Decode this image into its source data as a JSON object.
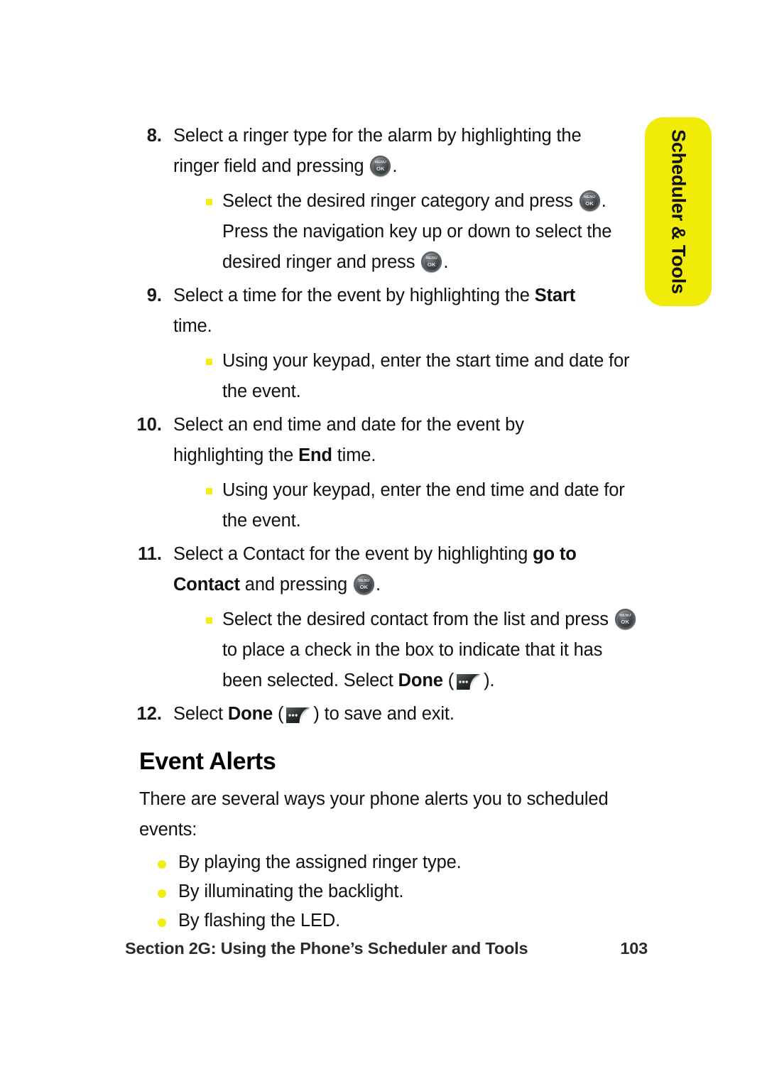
{
  "page": {
    "side_tab_label": "Scheduler & Tools",
    "tab_color": "#F0EC08",
    "bullet_color": "#F2EE12"
  },
  "icons": {
    "menu_ok": {
      "name": "menu-ok-key-icon",
      "top": "MENU",
      "bottom": "OK"
    },
    "softkey_done": {
      "name": "left-softkey-icon",
      "dots": "•••"
    }
  },
  "steps": [
    {
      "number": "8.",
      "text_a": "Select a ringer type for the alarm by highlighting the ringer field and pressing ",
      "text_b": ".",
      "subbullets": [
        {
          "text_a": "Select the desired ringer category and press ",
          "text_b": ". Press the navigation key up or down to select the desired ringer and press ",
          "text_c": "."
        }
      ]
    },
    {
      "number": "9.",
      "text_a": "Select a time for the event by highlighting the ",
      "bold": "Start",
      "text_b": " time.",
      "subbullets": [
        {
          "text_a": "Using your keypad, enter the start time and date for the event."
        }
      ]
    },
    {
      "number": "10.",
      "text_a": "Select an end time and date for the event by highlighting the ",
      "bold": "End",
      "text_b": " time.",
      "subbullets": [
        {
          "text_a": "Using your keypad, enter the end time and date for the event."
        }
      ]
    },
    {
      "number": "11.",
      "text_a": "Select a Contact for the event by highlighting ",
      "bold": "go to Contact",
      "text_b": " and pressing ",
      "text_c": ".",
      "subbullets": [
        {
          "text_a": "Select the desired contact from the list and press ",
          "text_b": " to place a check in the box to indicate that it has been selected. Select ",
          "bold": "Done",
          "text_c": " (",
          "text_d": ")."
        }
      ]
    },
    {
      "number": "12.",
      "text_a": "Select ",
      "bold": "Done",
      "text_b": " (",
      "text_c": ") to save and exit."
    }
  ],
  "section": {
    "heading": "Event Alerts",
    "intro": "There are several ways your phone alerts you to scheduled events:",
    "bullets": [
      "By playing the assigned ringer type.",
      "By illuminating the backlight.",
      "By flashing the LED."
    ]
  },
  "footer": {
    "title": "Section 2G: Using the Phone’s Scheduler and Tools",
    "page_number": "103"
  }
}
